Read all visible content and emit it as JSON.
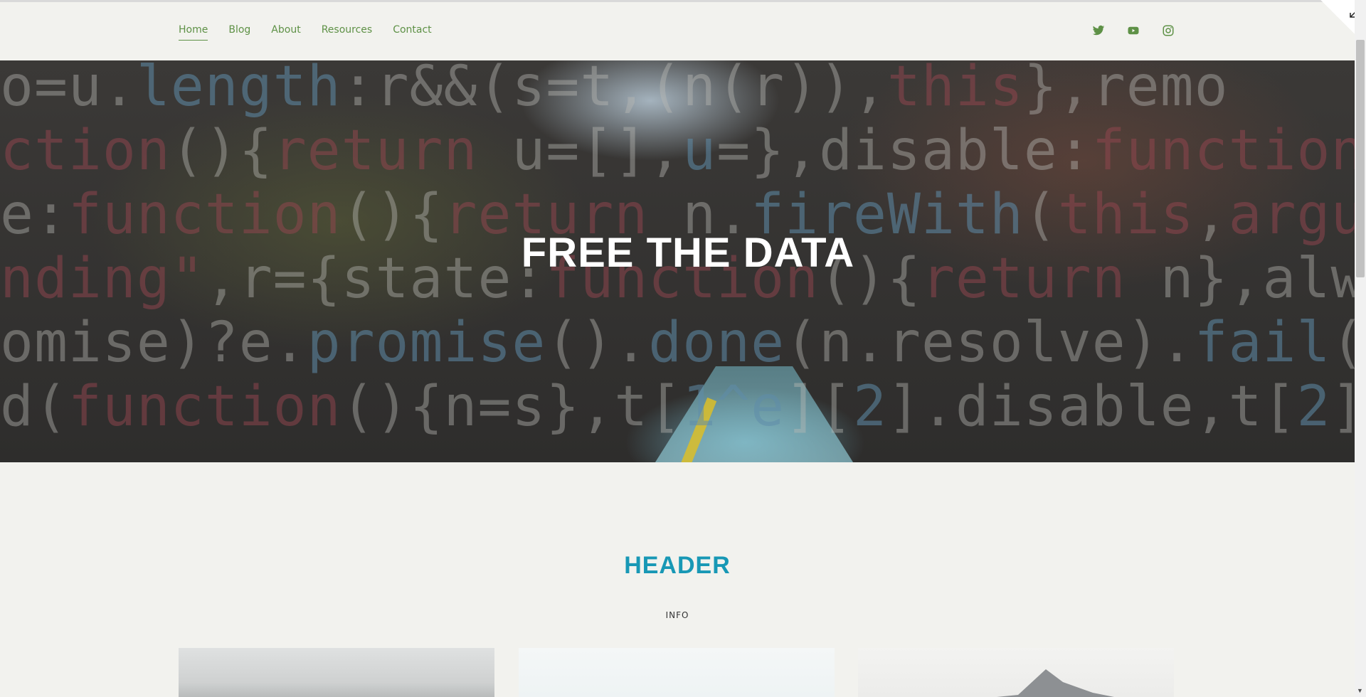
{
  "nav": {
    "items": [
      {
        "label": "Home",
        "active": true
      },
      {
        "label": "Blog",
        "active": false
      },
      {
        "label": "About",
        "active": false
      },
      {
        "label": "Resources",
        "active": false
      },
      {
        "label": "Contact",
        "active": false
      }
    ]
  },
  "social": {
    "icons": [
      "twitter-icon",
      "youtube-icon",
      "instagram-icon"
    ],
    "color": "#5e9146"
  },
  "hero": {
    "title": "FREE THE DATA"
  },
  "section": {
    "header": "HEADER",
    "info": "INFO",
    "header_color": "#1898b5"
  },
  "colors": {
    "accent": "#5e9146",
    "background": "#f2f2ee"
  }
}
